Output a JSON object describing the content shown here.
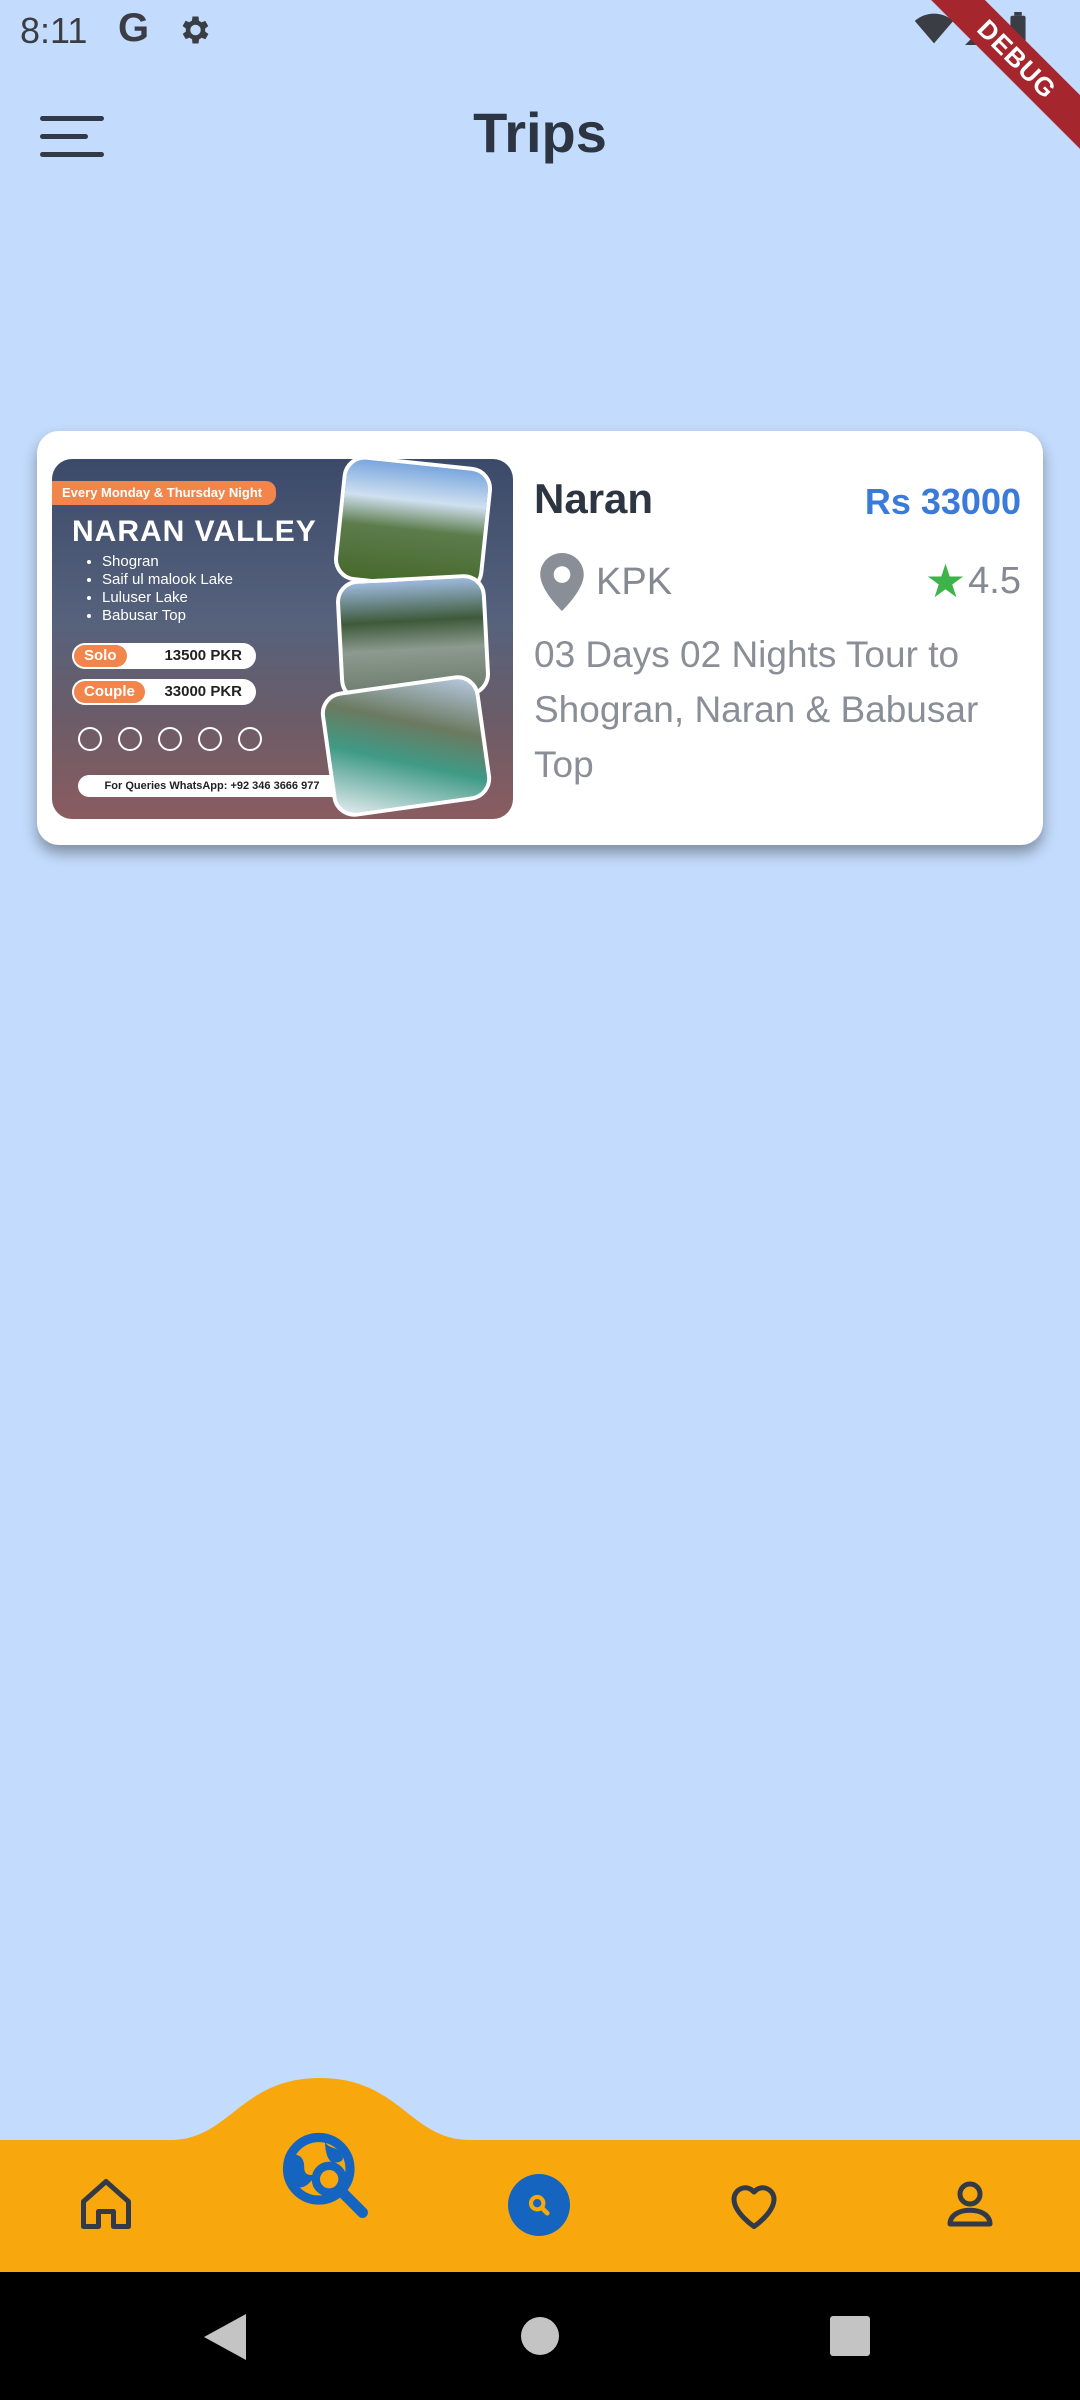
{
  "status_bar": {
    "time": "8:11",
    "google_glyph": "G",
    "icons": [
      "settings-gear-icon",
      "wifi-icon",
      "signal-icon",
      "battery-icon"
    ]
  },
  "debug_ribbon": "DEBUG",
  "app_bar": {
    "menu_icon": "hamburger-menu-icon",
    "title": "Trips"
  },
  "trips": [
    {
      "name": "Naran",
      "price": "Rs 33000",
      "region": "KPK",
      "rating": "4.5",
      "description": "03 Days 02 Nights Tour to Shogran, Naran & Babusar Top",
      "poster": {
        "tag": "Every Monday & Thursday Night",
        "title": "NARAN VALLEY",
        "stops": [
          "Shogran",
          "Saif ul malook Lake",
          "Luluser Lake",
          "Babusar Top"
        ],
        "solo_label": "Solo",
        "solo_price": "13500 PKR",
        "couple_label": "Couple",
        "couple_price": "33000 PKR",
        "contact": "For Queries WhatsApp: +92 346 3666 977"
      }
    }
  ],
  "bottom_nav": {
    "items": [
      "home-icon",
      "explore-icon",
      "search-icon",
      "favorites-icon",
      "profile-icon"
    ],
    "selected": "explore",
    "colors": {
      "bar": "#f8a70d",
      "icon": "#333a47",
      "accent": "#1565c0"
    }
  },
  "colors": {
    "background": "#c3dbfc",
    "price": "#3a7bd9",
    "star": "#3db34a"
  }
}
